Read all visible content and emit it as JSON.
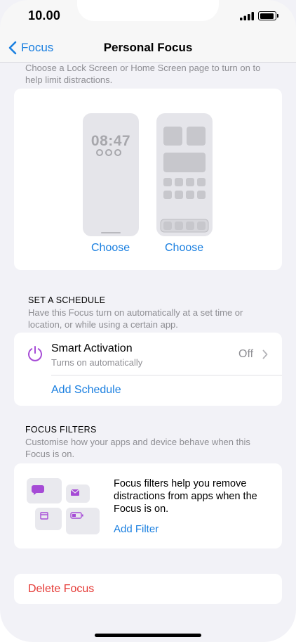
{
  "status_bar": {
    "time": "10.00"
  },
  "nav": {
    "back_label": "Focus",
    "title": "Personal Focus"
  },
  "page": {
    "description": "Choose a Lock Screen or Home Screen page to turn on to help limit distractions."
  },
  "screens": {
    "lock_time": "08:47",
    "choose_lock": "Choose",
    "choose_home": "Choose"
  },
  "schedule": {
    "header": "SET A SCHEDULE",
    "subtitle": "Have this Focus turn on automatically at a set time or location, or while using a certain app.",
    "smart_activation": {
      "title": "Smart Activation",
      "subtitle": "Turns on automatically",
      "value": "Off"
    },
    "add_schedule": "Add Schedule"
  },
  "filters": {
    "header": "FOCUS FILTERS",
    "subtitle": "Customise how your apps and device behave when this Focus is on.",
    "body": "Focus filters help you remove distractions from apps when the Focus is on.",
    "add_filter": "Add Filter"
  },
  "delete_label": "Delete Focus",
  "colors": {
    "accent": "#1a7fe0",
    "destructive": "#e53935",
    "purple": "#a64bd6",
    "secondary_text": "#8e8e93",
    "background": "#f2f2f7"
  }
}
